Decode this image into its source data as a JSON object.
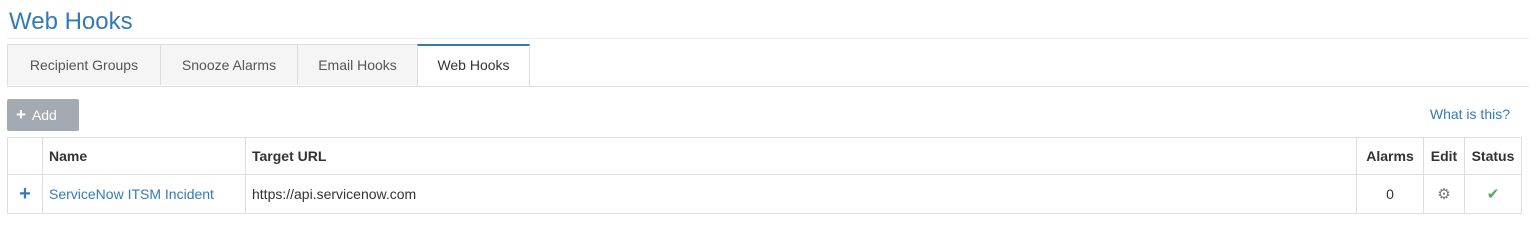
{
  "page": {
    "title": "Web Hooks"
  },
  "tabs": [
    {
      "label": "Recipient Groups"
    },
    {
      "label": "Snooze Alarms"
    },
    {
      "label": "Email Hooks"
    },
    {
      "label": "Web Hooks",
      "active": true
    }
  ],
  "toolbar": {
    "add_label": "Add",
    "help_link": "What is this?"
  },
  "table": {
    "columns": [
      "Name",
      "Target URL",
      "Alarms",
      "Edit",
      "Status"
    ],
    "rows": [
      {
        "name": "ServiceNow ITSM Incident",
        "target_url": "https://api.servicenow.com",
        "alarms": "0",
        "edit_icon": "gear-icon",
        "status_icon": "check-icon"
      }
    ]
  },
  "colors": {
    "accent": "#337ab7",
    "button": "#a3aab1",
    "status_ok": "#4caf50"
  }
}
